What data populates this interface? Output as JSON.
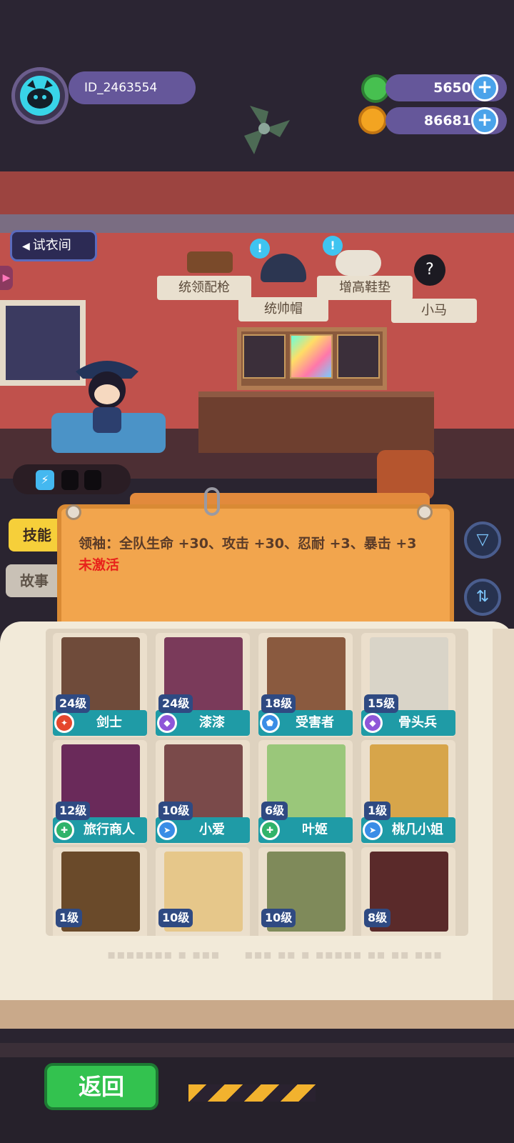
{
  "player": {
    "id": "ID_2463554"
  },
  "currencies": [
    {
      "icon": "green-coin-icon",
      "value": "5650",
      "plus": "+"
    },
    {
      "icon": "orange-planet-coin-icon",
      "value": "86681",
      "plus": "+"
    }
  ],
  "room": {
    "fitting_room_label": "试衣间",
    "items": [
      {
        "label": "统领配枪",
        "icon": "pistol-icon"
      },
      {
        "label": "统帅帽",
        "icon": "bicorne-hat-icon"
      },
      {
        "label": "增高鞋垫",
        "icon": "insole-icon"
      },
      {
        "label": "小马",
        "icon": "mystery-icon",
        "mystery_glyph": "?"
      }
    ],
    "tip_glyph": "!"
  },
  "tabs": [
    {
      "label": "技能",
      "active": true
    },
    {
      "label": "故事",
      "active": false
    }
  ],
  "skill": {
    "description": "领袖：全队生命 +30、攻击 +30、忍耐 +3、暴击 +3",
    "status": "未激活"
  },
  "side_buttons": [
    {
      "icon": "filter-icon",
      "glyph": "▽"
    },
    {
      "icon": "sort-icon",
      "glyph": "⇅"
    }
  ],
  "characters": [
    {
      "name": "剑士",
      "level": "24级",
      "role": "attack",
      "role_color": "#e5472d",
      "art_color": "#6f4b3a"
    },
    {
      "name": "漆漆",
      "level": "24级",
      "role": "magic",
      "role_color": "#8e56d8",
      "art_color": "#7a3a5a"
    },
    {
      "name": "受害者",
      "level": "18级",
      "role": "defense",
      "role_color": "#3a8de6",
      "art_color": "#8a5a3f"
    },
    {
      "name": "骨头兵",
      "level": "15级",
      "role": "magic",
      "role_color": "#8e56d8",
      "art_color": "#d9d4c8"
    },
    {
      "name": "旅行商人",
      "level": "12级",
      "role": "support",
      "role_color": "#2fb36a",
      "art_color": "#6a2a5a"
    },
    {
      "name": "小爱",
      "level": "10级",
      "role": "speed",
      "role_color": "#3a8de6",
      "art_color": "#7a4a4a"
    },
    {
      "name": "叶姬",
      "level": "6级",
      "role": "support",
      "role_color": "#2fb36a",
      "art_color": "#9ac77a"
    },
    {
      "name": "桃几小姐",
      "level": "1级",
      "role": "speed",
      "role_color": "#3a8de6",
      "art_color": "#d7a54a"
    },
    {
      "name": "",
      "level": "1级",
      "role": "",
      "role_color": "",
      "art_color": "#6a4a2a"
    },
    {
      "name": "",
      "level": "10级",
      "role": "",
      "role_color": "",
      "art_color": "#e6c78a"
    },
    {
      "name": "",
      "level": "10级",
      "role": "",
      "role_color": "",
      "art_color": "#7f8a5a"
    },
    {
      "name": "",
      "level": "8级",
      "role": "",
      "role_color": "",
      "art_color": "#5a2a2a"
    }
  ],
  "footer": {
    "back_label": "返回"
  },
  "colors": {
    "accent": "#65579a",
    "teal": "#1f9ba6",
    "green": "#33c24f",
    "orange": "#f2a54d"
  }
}
